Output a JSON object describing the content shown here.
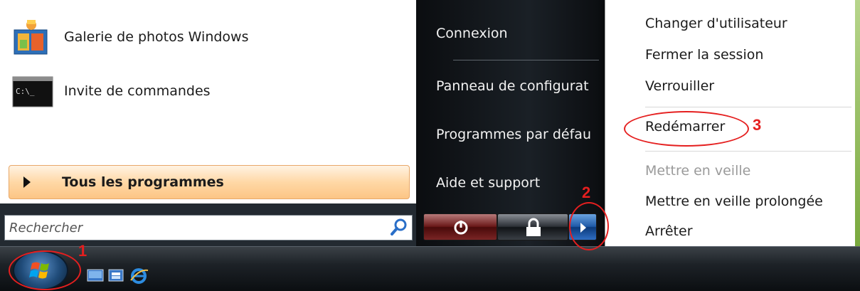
{
  "left_pane": {
    "programs": [
      {
        "label": "Galerie de photos Windows",
        "icon": "photo-gallery-icon"
      },
      {
        "label": "Invite de commandes",
        "icon": "command-prompt-icon",
        "icon_text": "C:\\_"
      }
    ],
    "all_programs": "Tous les programmes",
    "search_placeholder": "Rechercher"
  },
  "right_pane": {
    "items": [
      "Connexion",
      "Panneau de configurat",
      "Programmes par défau",
      "Aide et support"
    ]
  },
  "submenu": {
    "items": [
      {
        "label": "Changer d'utilisateur",
        "enabled": true
      },
      {
        "label": "Fermer la session",
        "enabled": true
      },
      {
        "label": "Verrouiller",
        "enabled": true
      },
      {
        "label": "Redémarrer",
        "enabled": true
      },
      {
        "label": "Mettre en veille",
        "enabled": false
      },
      {
        "label": "Mettre en veille prolongée",
        "enabled": true
      },
      {
        "label": "Arrêter",
        "enabled": true
      }
    ]
  },
  "annotations": {
    "one": "1",
    "two": "2",
    "three": "3"
  },
  "colors": {
    "annotation": "#e51f1f",
    "highlight": "#ffd8a6",
    "menu_bg": "#ffffff",
    "pane_dark": "#1a2026"
  }
}
